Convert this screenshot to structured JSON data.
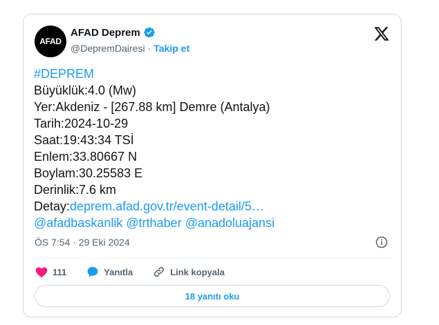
{
  "author": {
    "avatar_text": "AFAD",
    "display_name": "AFAD Deprem",
    "handle": "@DepremDairesi",
    "separator": "·",
    "follow_label": "Takip et"
  },
  "tweet": {
    "lines": [
      {
        "prefix": "",
        "text": "#DEPREM",
        "is_link": true
      },
      {
        "prefix": "",
        "text": "Büyüklük:4.0 (Mw)",
        "is_link": false
      },
      {
        "prefix": "",
        "text": "Yer:Akdeniz - [267.88 km] Demre (Antalya)",
        "is_link": false
      },
      {
        "prefix": "",
        "text": "Tarih:2024-10-29",
        "is_link": false
      },
      {
        "prefix": "",
        "text": "Saat:19:43:34 TSİ",
        "is_link": false
      },
      {
        "prefix": "",
        "text": "Enlem:33.80667 N",
        "is_link": false
      },
      {
        "prefix": "",
        "text": "Boylam:30.25583 E",
        "is_link": false
      },
      {
        "prefix": "",
        "text": "Derinlik:7.6 km",
        "is_link": false
      }
    ],
    "detail_label": "Detay:",
    "detail_link": "deprem.afad.gov.tr/event-detail/5…",
    "mentions": [
      "@afadbaskanlik",
      "@trthaber",
      "@anadoluajansi"
    ],
    "timestamp": "ÖS 7:54 · 29 Eki 2024"
  },
  "actions": {
    "like_count": "111",
    "reply_label": "Yanıtla",
    "copy_link_label": "Link kopyala"
  },
  "replies_button_label": "18 yanıtı oku",
  "colors": {
    "accent": "#1d9bf0",
    "like": "#f91880",
    "text": "#0f1419",
    "muted": "#536471",
    "border": "#cfd9de"
  }
}
